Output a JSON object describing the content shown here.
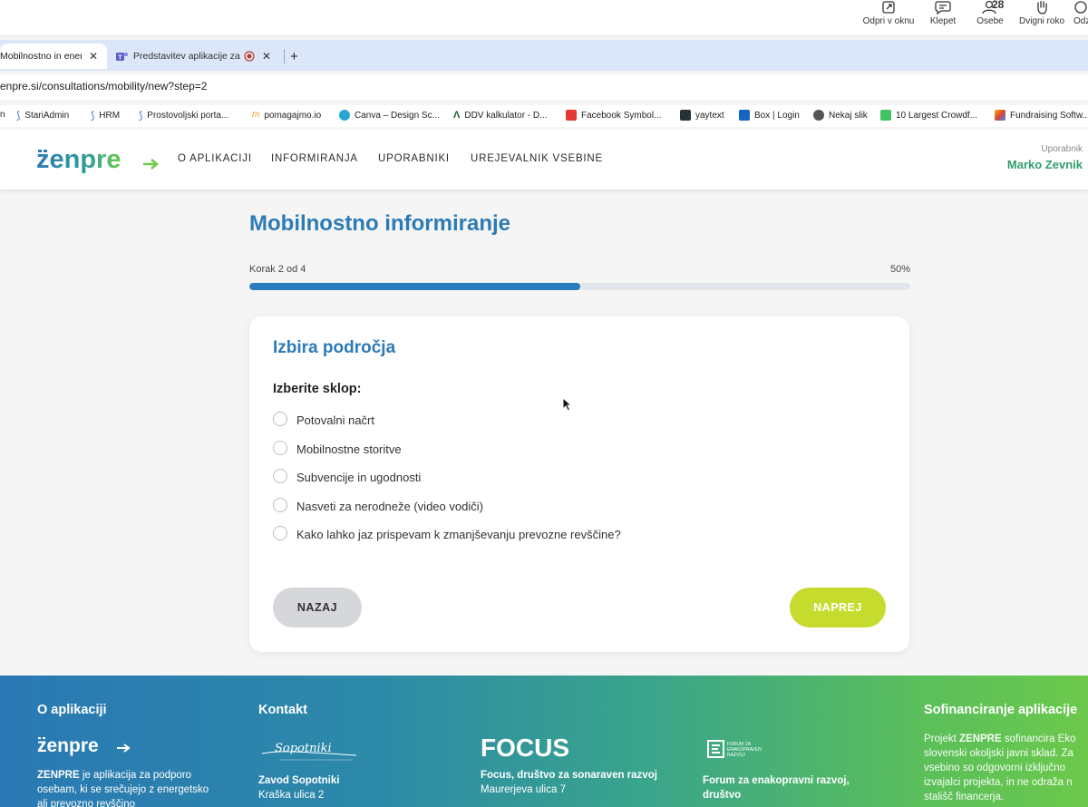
{
  "teams_bar": {
    "buttons": [
      {
        "label": "Odpri v oknu",
        "icon": "open-in-window-icon"
      },
      {
        "label": "Klepet",
        "icon": "chat-icon"
      },
      {
        "label": "Osebe",
        "icon": "people-icon",
        "count": "28"
      },
      {
        "label": "Dvigni roko",
        "icon": "raise-hand-icon"
      },
      {
        "label": "Odz",
        "icon": "react-icon"
      }
    ]
  },
  "browser": {
    "tabs": [
      {
        "title": "Mobilnostno in ener",
        "active": true
      },
      {
        "title": "Predstavitev aplikacije za",
        "active": false
      }
    ],
    "url": "enpre.si/consultations/mobility/new?step=2",
    "bookmarks": [
      {
        "label": "n"
      },
      {
        "label": "StariAdmin"
      },
      {
        "label": "HRM"
      },
      {
        "label": "Prostovoljski porta..."
      },
      {
        "label": "pomagajmo.io"
      },
      {
        "label": "Canva – Design Sc..."
      },
      {
        "label": "DDV kalkulator - D..."
      },
      {
        "label": "Facebook Symbol..."
      },
      {
        "label": "yaytext"
      },
      {
        "label": "Box | Login"
      },
      {
        "label": "Nekaj slik"
      },
      {
        "label": "10 Largest Crowdf..."
      },
      {
        "label": "Fundraising Softw..."
      }
    ]
  },
  "header": {
    "logo_text": "zenpre",
    "nav": [
      "O APLIKACIJI",
      "INFORMIRANJA",
      "UPORABNIKI",
      "UREJEVALNIK VSEBINE"
    ],
    "user_role": "Uporabnik",
    "user_name": "Marko Zevnik"
  },
  "main": {
    "title": "Mobilnostno informiranje",
    "step_label": "Korak 2 od 4",
    "progress_percent_label": "50%",
    "progress_fraction": 0.5,
    "card": {
      "title": "Izbira področja",
      "question": "Izberite sklop:",
      "options": [
        "Potovalni načrt",
        "Mobilnostne storitve",
        "Subvencije in ugodnosti",
        "Nasveti za nerodneže (video vodiči)",
        "Kako lahko jaz prispevam k zmanjševanju prevozne revščine?"
      ],
      "back_label": "NAZAJ",
      "next_label": "NAPREJ"
    }
  },
  "footer": {
    "about_heading": "O aplikaciji",
    "about_logo": "zenpre",
    "about_brand": "ZENPRE",
    "about_text_1": " je aplikacija za podporo",
    "about_text_2": "osebam, ki se srečujejo z energetsko",
    "about_text_3": "ali prevozno revščino",
    "contact_heading": "Kontakt",
    "contact_logo": "Sopotniki",
    "contact_name": "Zavod Sopotniki",
    "contact_address": "Kraška ulica 2",
    "focus_logo": "FOCUS",
    "focus_name": "Focus, društvo za sonaraven razvoj",
    "focus_address": "Maurerjeva ulica 7",
    "forum_logo_text": "FORUM ZA ENAKOPRAVEN RAZVOJ",
    "forum_name_1": "Forum za enakopravni razvoj,",
    "forum_name_2": "društvo",
    "funding_heading": "Sofinanciranje aplikacije",
    "funding_text_1a": "Projekt ",
    "funding_brand": "ZENPRE",
    "funding_text_1b": " sofinancira Eko",
    "funding_text_2": "slovenski okoljski javni sklad. Za",
    "funding_text_3": "vsebino so odgovorni izključno",
    "funding_text_4": "izvajalci projekta, in ne odraža n",
    "funding_text_5": "stališč financerja."
  }
}
